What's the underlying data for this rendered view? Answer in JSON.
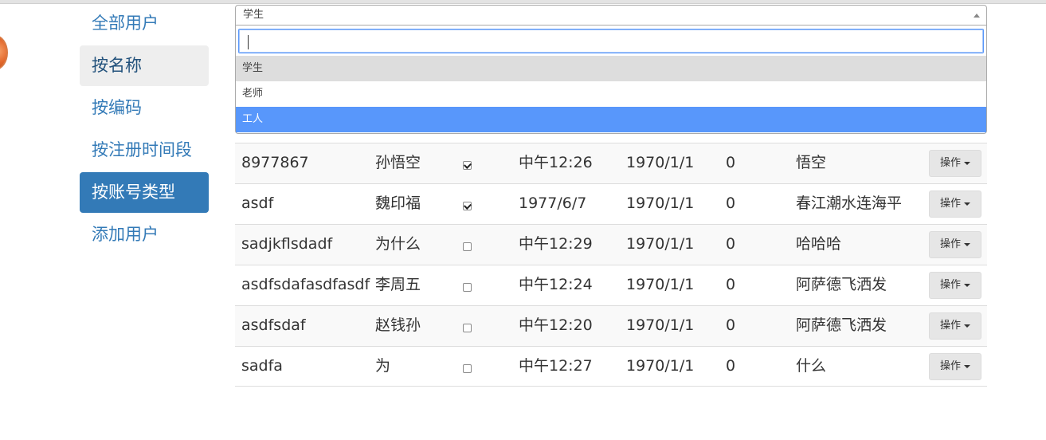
{
  "sidebar": {
    "items": [
      {
        "label": "全部用户",
        "state": "normal"
      },
      {
        "label": "按名称",
        "state": "hover"
      },
      {
        "label": "按编码",
        "state": "normal"
      },
      {
        "label": "按注册时间段",
        "state": "normal"
      },
      {
        "label": "按账号类型",
        "state": "active"
      },
      {
        "label": "添加用户",
        "state": "normal"
      }
    ]
  },
  "select": {
    "value": "学生",
    "search_value": "",
    "options": [
      "学生",
      "老师",
      "工人"
    ],
    "selected_index": 0,
    "highlighted_index": 2
  },
  "table": {
    "rows": [
      {
        "code": "8977867",
        "name": "孙悟空",
        "checked": true,
        "time": "中午12:26",
        "date": "1970/1/1",
        "num": "0",
        "desc": "悟空",
        "action": "操作"
      },
      {
        "code": "asdf",
        "name": "魏印福",
        "checked": true,
        "time": "1977/6/7",
        "date": "1970/1/1",
        "num": "0",
        "desc": "春江潮水连海平",
        "action": "操作"
      },
      {
        "code": "sadjkflsdadf",
        "name": "为什么",
        "checked": false,
        "time": "中午12:29",
        "date": "1970/1/1",
        "num": "0",
        "desc": "哈哈哈",
        "action": "操作"
      },
      {
        "code": "asdfsdafasdfasdf",
        "name": "李周五",
        "checked": false,
        "time": "中午12:24",
        "date": "1970/1/1",
        "num": "0",
        "desc": "阿萨德飞洒发",
        "action": "操作"
      },
      {
        "code": "asdfsdaf",
        "name": "赵钱孙",
        "checked": false,
        "time": "中午12:20",
        "date": "1970/1/1",
        "num": "0",
        "desc": "阿萨德飞洒发",
        "action": "操作"
      },
      {
        "code": "sadfa",
        "name": "为",
        "checked": false,
        "time": "中午12:27",
        "date": "1970/1/1",
        "num": "0",
        "desc": "什么",
        "action": "操作"
      }
    ]
  },
  "colors": {
    "link": "#337ab7",
    "active_bg": "#337ab7",
    "highlight": "#5897fb"
  }
}
